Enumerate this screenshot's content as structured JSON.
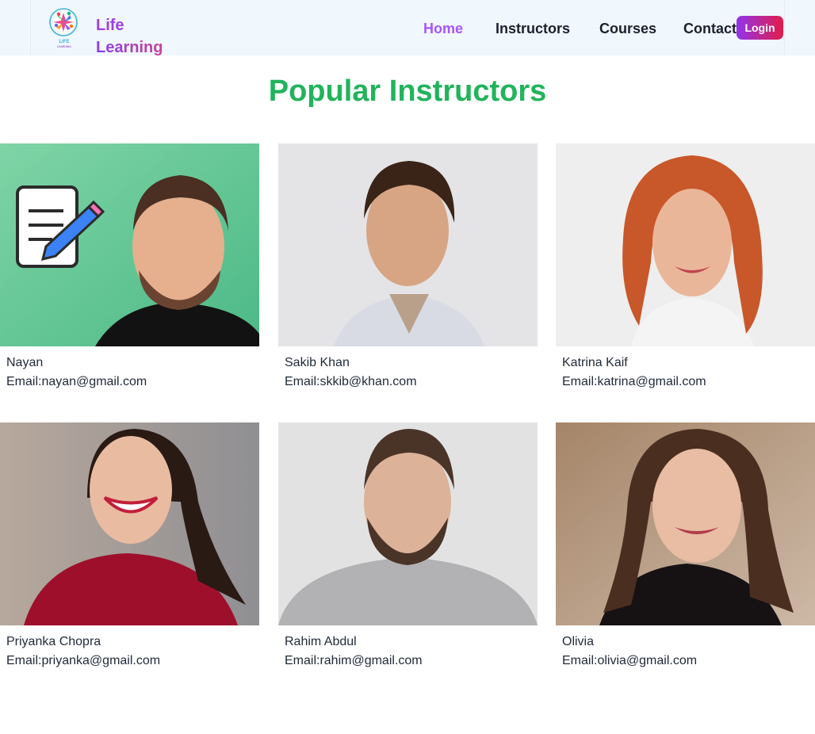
{
  "brand": {
    "logo_icon": "life-learning-logo-icon",
    "logo_small_text": "LIFE LEARNING",
    "line1": "Life",
    "line2": "Learning"
  },
  "nav": {
    "items": [
      {
        "label": "Home",
        "active": true
      },
      {
        "label": "Instructors",
        "active": false
      },
      {
        "label": "Courses",
        "active": false
      },
      {
        "label": "Contact",
        "active": false
      }
    ],
    "login_label": "Login"
  },
  "colors": {
    "nav_background": "#f0f7fd",
    "active_link": "#a855f7",
    "title": "#22b35c",
    "login_gradient_start": "#9333ea",
    "login_gradient_end": "#e11d48"
  },
  "page_title": "Popular Instructors",
  "email_prefix": "Email:",
  "instructors": [
    {
      "name": "Nayan",
      "email": "nayan@gmail.com",
      "photo": "instructor-photo"
    },
    {
      "name": "Sakib Khan",
      "email": "skkib@khan.com",
      "photo": "instructor-photo"
    },
    {
      "name": "Katrina Kaif",
      "email": "katrina@gmail.com",
      "photo": "instructor-photo"
    },
    {
      "name": "Priyanka Chopra",
      "email": "priyanka@gmail.com",
      "photo": "instructor-photo"
    },
    {
      "name": "Rahim Abdul",
      "email": "rahim@gmail.com",
      "photo": "instructor-photo"
    },
    {
      "name": "Olivia",
      "email": "olivia@gmail.com",
      "photo": "instructor-photo"
    }
  ]
}
